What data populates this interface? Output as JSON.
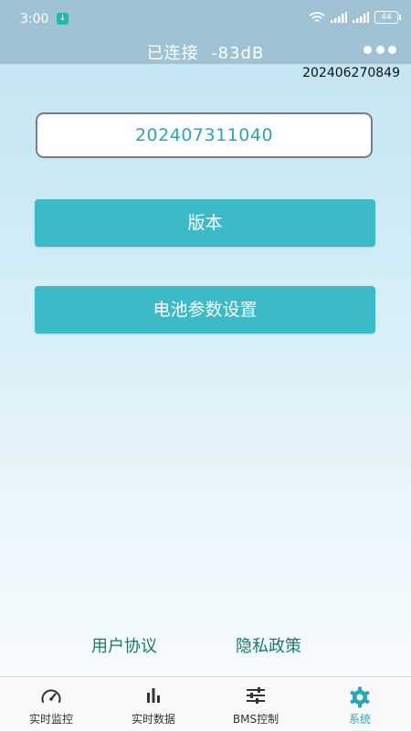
{
  "status_bar": {
    "time": "3:00",
    "battery_level": "44",
    "icons": [
      "download-notification-icon",
      "wifi-icon",
      "signal-icon",
      "signal-icon",
      "battery-icon"
    ]
  },
  "header": {
    "title": "已连接  -83dB",
    "menu_icon": "more-dots-icon",
    "device_id": "202406270849"
  },
  "main": {
    "serial_value": "202407311040",
    "version_button": "版本",
    "battery_settings_button": "电池参数设置"
  },
  "footer_links": {
    "user_agreement": "用户协议",
    "privacy_policy": "隐私政策"
  },
  "tabbar": {
    "active_color": "#2aa7b5",
    "tabs": [
      {
        "label": "实时监控",
        "icon": "gauge-icon"
      },
      {
        "label": "实时数据",
        "icon": "bar-chart-icon"
      },
      {
        "label": "BMS控制",
        "icon": "sliders-icon"
      },
      {
        "label": "系统",
        "icon": "gear-icon"
      }
    ]
  }
}
